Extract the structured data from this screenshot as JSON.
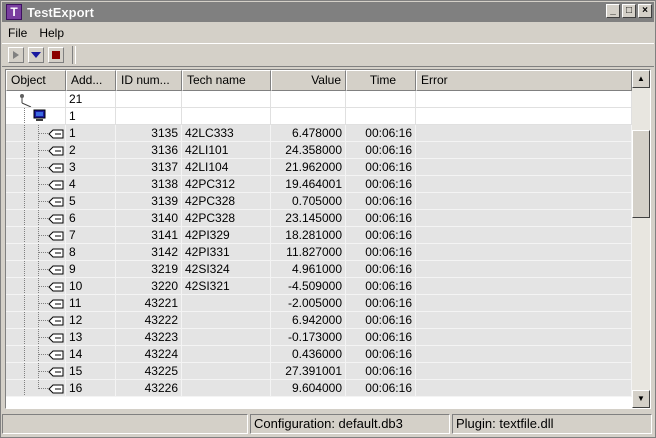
{
  "window": {
    "title": "TestExport",
    "app_icon_letter": "T"
  },
  "menu": [
    "File",
    "Help"
  ],
  "toolbar": {
    "play_icon": "play-icon",
    "step_icon": "dropdown-arrow-icon",
    "stop_icon": "stop-icon"
  },
  "table": {
    "columns": [
      "Object",
      "Add...",
      "ID num...",
      "Tech name",
      "Value",
      "Time",
      "Error"
    ],
    "root_address": "21",
    "group_address": "1",
    "rows": [
      {
        "addr": "1",
        "id": "3135",
        "tech": "42LC333",
        "value": "6.478000",
        "time": "00:06:16",
        "error": ""
      },
      {
        "addr": "2",
        "id": "3136",
        "tech": "42LI101",
        "value": "24.358000",
        "time": "00:06:16",
        "error": ""
      },
      {
        "addr": "3",
        "id": "3137",
        "tech": "42LI104",
        "value": "21.962000",
        "time": "00:06:16",
        "error": ""
      },
      {
        "addr": "4",
        "id": "3138",
        "tech": "42PC312",
        "value": "19.464001",
        "time": "00:06:16",
        "error": ""
      },
      {
        "addr": "5",
        "id": "3139",
        "tech": "42PC328",
        "value": "0.705000",
        "time": "00:06:16",
        "error": ""
      },
      {
        "addr": "6",
        "id": "3140",
        "tech": "42PC328",
        "value": "23.145000",
        "time": "00:06:16",
        "error": ""
      },
      {
        "addr": "7",
        "id": "3141",
        "tech": "42PI329",
        "value": "18.281000",
        "time": "00:06:16",
        "error": ""
      },
      {
        "addr": "8",
        "id": "3142",
        "tech": "42PI331",
        "value": "11.827000",
        "time": "00:06:16",
        "error": ""
      },
      {
        "addr": "9",
        "id": "3219",
        "tech": "42SI324",
        "value": "4.961000",
        "time": "00:06:16",
        "error": ""
      },
      {
        "addr": "10",
        "id": "3220",
        "tech": "42SI321",
        "value": "-4.509000",
        "time": "00:06:16",
        "error": ""
      },
      {
        "addr": "11",
        "id": "43221",
        "tech": "",
        "value": "-2.005000",
        "time": "00:06:16",
        "error": ""
      },
      {
        "addr": "12",
        "id": "43222",
        "tech": "",
        "value": "6.942000",
        "time": "00:06:16",
        "error": ""
      },
      {
        "addr": "13",
        "id": "43223",
        "tech": "",
        "value": "-0.173000",
        "time": "00:06:16",
        "error": ""
      },
      {
        "addr": "14",
        "id": "43224",
        "tech": "",
        "value": "0.436000",
        "time": "00:06:16",
        "error": ""
      },
      {
        "addr": "15",
        "id": "43225",
        "tech": "",
        "value": "27.391001",
        "time": "00:06:16",
        "error": ""
      },
      {
        "addr": "16",
        "id": "43226",
        "tech": "",
        "value": "9.604000",
        "time": "00:06:16",
        "error": ""
      }
    ]
  },
  "status": {
    "left": "",
    "configuration": "Configuration: default.db3",
    "plugin": "Plugin: textfile.dll"
  },
  "colors": {
    "stop": "#8b0000",
    "step": "#1a1aa0",
    "row_shade": "#e4e4e4"
  }
}
